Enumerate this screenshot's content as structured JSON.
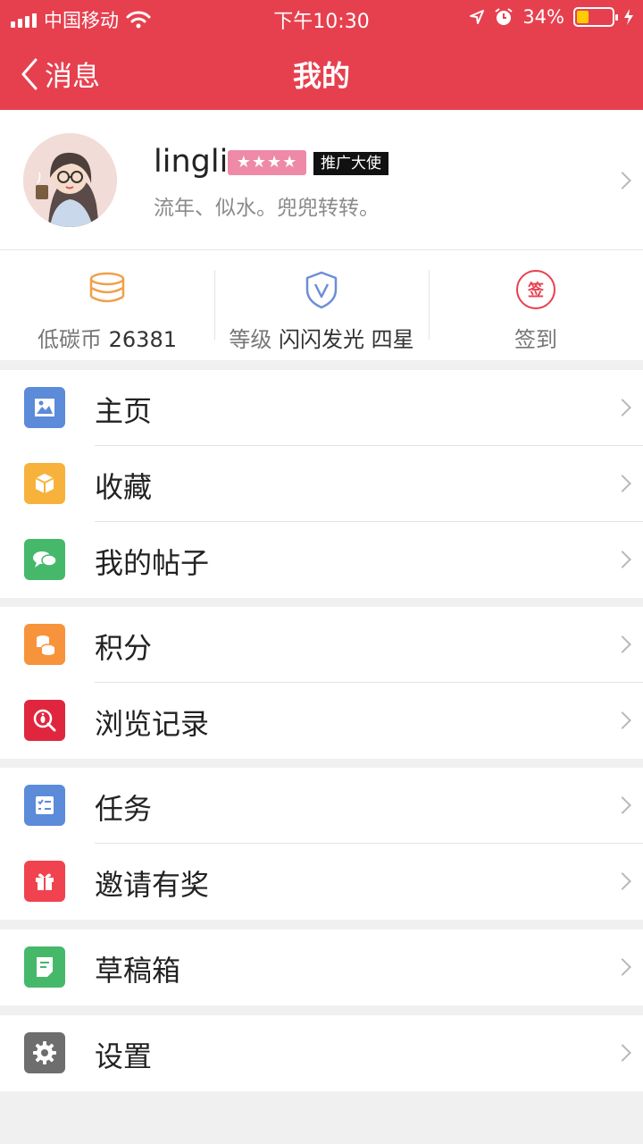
{
  "status": {
    "carrier": "中国移动",
    "time": "下午10:30",
    "battery": "34%"
  },
  "nav": {
    "back_label": "消息",
    "title": "我的"
  },
  "profile": {
    "name": "lingli",
    "badge": "推广大使",
    "signature": "流年、似水。兜兜转转。",
    "stars": 4
  },
  "stats": {
    "coin_label": "低碳币",
    "coin_value": "26381",
    "level_label": "等级",
    "level_value": "闪闪发光 四星",
    "checkin_label": "签到",
    "checkin_icon_text": "签"
  },
  "menu": {
    "home": "主页",
    "favorites": "收藏",
    "posts": "我的帖子",
    "points": "积分",
    "history": "浏览记录",
    "tasks": "任务",
    "invite": "邀请有奖",
    "drafts": "草稿箱",
    "settings": "设置"
  },
  "colors": {
    "accent": "#e6404f",
    "star_badge": "#ee8aa7"
  }
}
